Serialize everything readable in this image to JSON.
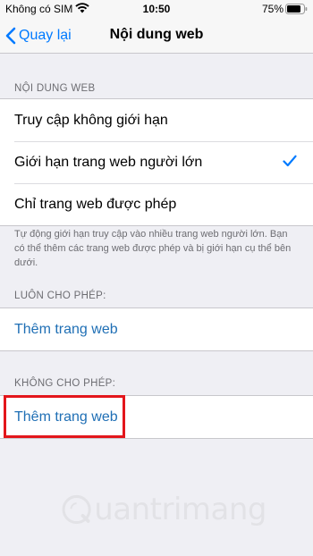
{
  "status_bar": {
    "carrier": "Không có SIM",
    "time": "10:50",
    "battery_pct": "75%"
  },
  "nav": {
    "back_label": "Quay lại",
    "title": "Nội dung web"
  },
  "web_content": {
    "header": "NỘI DUNG WEB",
    "options": [
      {
        "label": "Truy cập không giới hạn",
        "selected": false
      },
      {
        "label": "Giới hạn trang web người lớn",
        "selected": true
      },
      {
        "label": "Chỉ trang web được phép",
        "selected": false
      }
    ],
    "footer": "Tự động giới hạn truy cập vào nhiều trang web người lớn. Bạn có thể thêm các trang web được phép và bị giới hạn cụ thể bên dưới."
  },
  "always_allow": {
    "header": "LUÔN CHO PHÉP:",
    "add_label": "Thêm trang web"
  },
  "never_allow": {
    "header": "KHÔNG CHO PHÉP:",
    "add_label": "Thêm trang web"
  },
  "watermark": {
    "text": "uantrimang"
  },
  "colors": {
    "accent": "#007aff",
    "link": "#1f6fb5",
    "highlight": "#e3161b",
    "background": "#efeff4"
  },
  "icons": {
    "wifi": "wifi-icon",
    "battery": "battery-icon",
    "back": "chevron-left-icon",
    "check": "checkmark-icon"
  }
}
